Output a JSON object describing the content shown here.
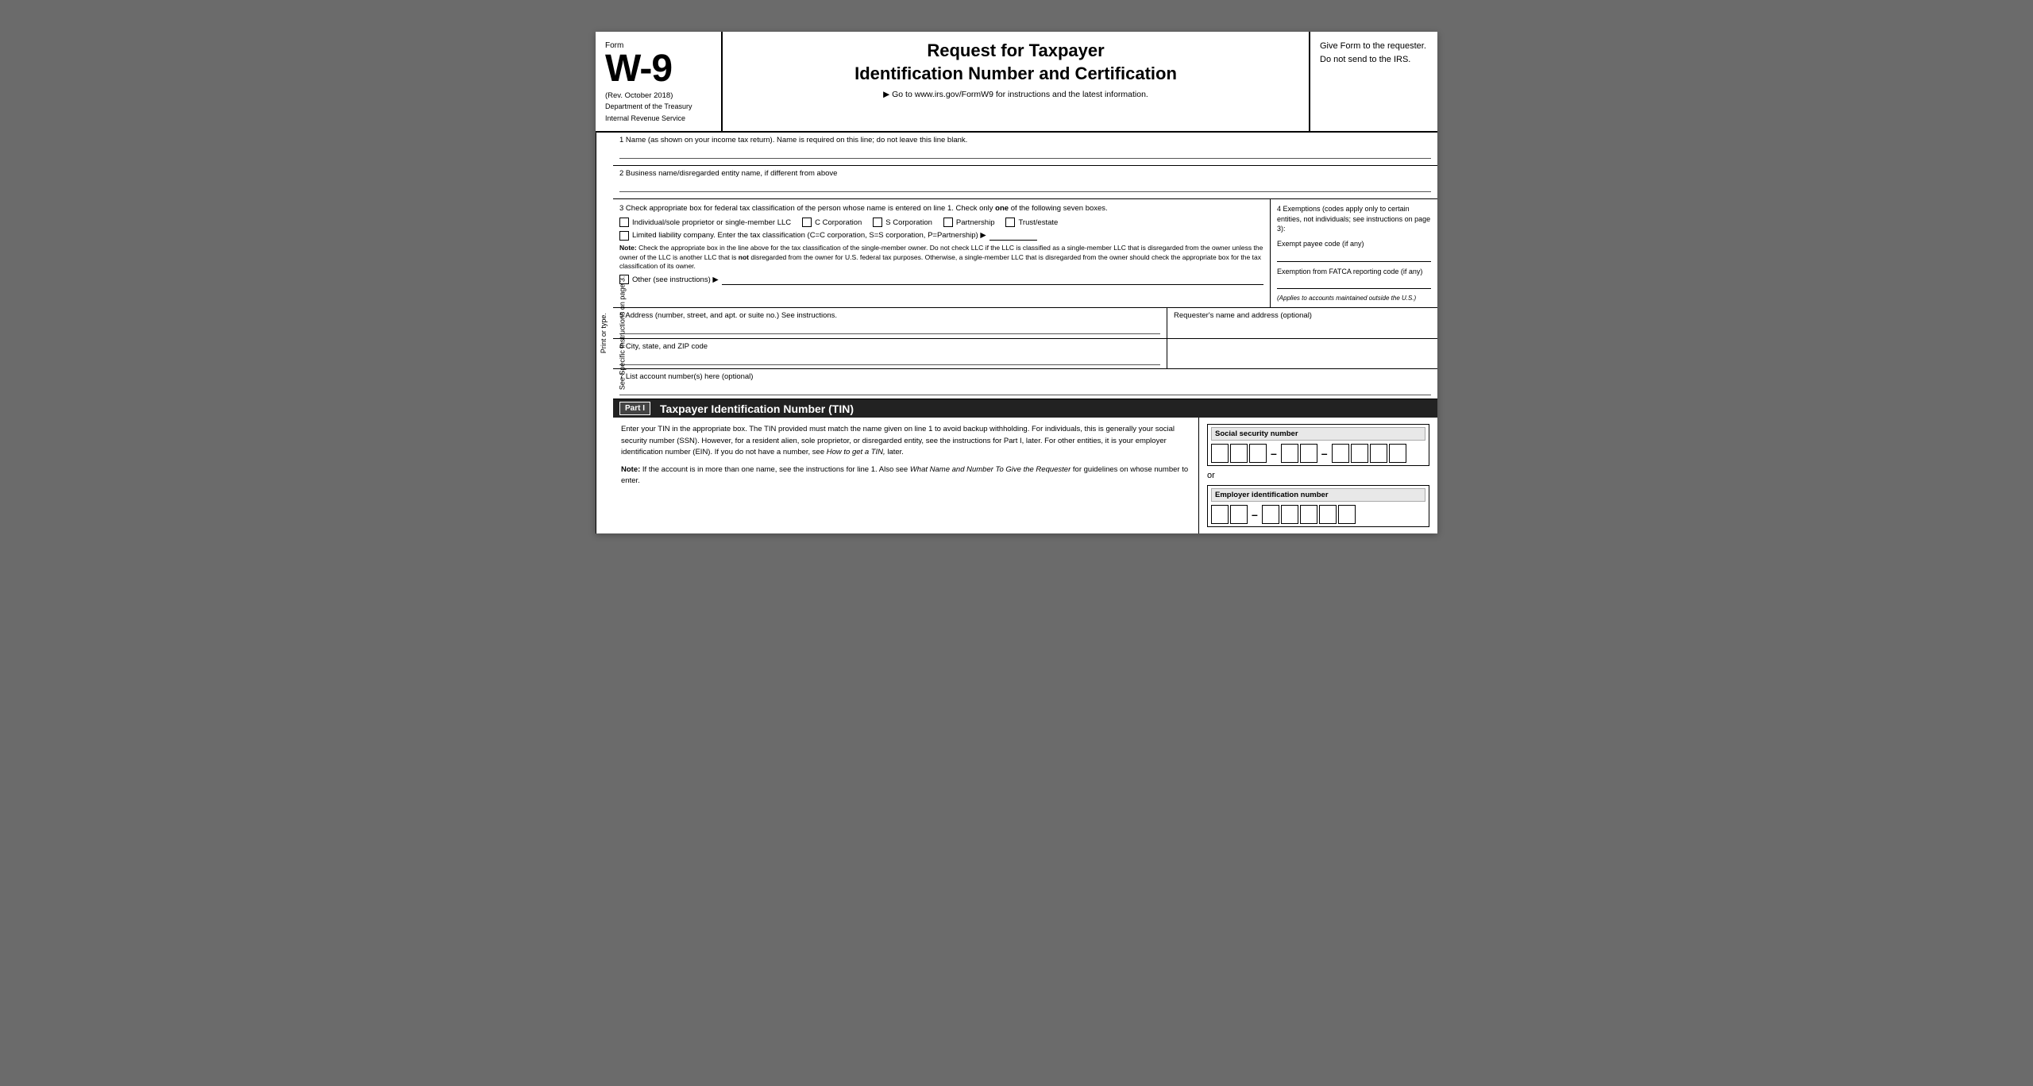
{
  "header": {
    "form_word": "Form",
    "form_number": "W-9",
    "rev": "(Rev. October 2018)",
    "dept1": "Department of the Treasury",
    "dept2": "Internal Revenue Service",
    "title_line1": "Request for Taxpayer",
    "title_line2": "Identification Number and Certification",
    "goto": "▶ Go to www.irs.gov/FormW9 for instructions and the latest information.",
    "give_form": "Give Form to the requester. Do not send to the IRS."
  },
  "fields": {
    "line1_label": "1  Name (as shown on your income tax return). Name is required on this line; do not leave this line blank.",
    "line2_label": "2  Business name/disregarded entity name, if different from above",
    "line3_label": "3  Check appropriate box for federal tax classification of the person whose name is entered on line 1. Check only",
    "line3_label_bold": "one",
    "line3_label_end": "of the following seven boxes.",
    "cb1": "Individual/sole proprietor or single-member LLC",
    "cb2": "C Corporation",
    "cb3": "S Corporation",
    "cb4": "Partnership",
    "cb5": "Trust/estate",
    "llc_text": "Limited liability company. Enter the tax classification (C=C corporation, S=S corporation, P=Partnership) ▶",
    "note_label": "Note:",
    "note_text": "Check the appropriate box in the line above for the tax classification of the single-member owner.  Do not check LLC if the LLC is classified as a single-member LLC that is disregarded from the owner unless the owner of the LLC is another LLC that is",
    "note_not": "not",
    "note_text2": "disregarded from the owner for U.S. federal tax purposes. Otherwise, a single-member LLC that is disregarded from the owner should check the appropriate box for the tax classification of its owner.",
    "other_text": "Other (see instructions) ▶",
    "exemptions_title": "4  Exemptions (codes apply only to certain entities, not individuals; see instructions on page 3):",
    "exempt_payee_label": "Exempt payee code (if any)",
    "exempt_fatca_label": "Exemption from FATCA reporting code (if any)",
    "exempt_applies": "(Applies to accounts maintained outside the U.S.)",
    "line5_label": "5  Address (number, street, and apt. or suite no.) See instructions.",
    "requester_label": "Requester's name and address (optional)",
    "line6_label": "6  City, state, and ZIP code",
    "line7_label": "7  List account number(s) here (optional)"
  },
  "part1": {
    "part_label": "Part I",
    "part_title": "Taxpayer Identification Number (TIN)",
    "body_text": "Enter your TIN in the appropriate box. The TIN provided must match the name given on line 1 to avoid backup withholding. For individuals, this is generally your social security number (SSN). However, for a resident alien, sole proprietor, or disregarded entity, see the instructions for Part I, later. For other entities, it is your employer identification number (EIN). If you do not have a number, see",
    "how_to_get": "How to get a TIN,",
    "body_text2": "later.",
    "note_label": "Note:",
    "note_text": "If the account is in more than one name, see the instructions for line 1. Also see",
    "what_name": "What Name and Number To Give the Requester",
    "note_text2": "for guidelines on whose number to enter.",
    "ssn_label": "Social security number",
    "or_text": "or",
    "ein_label": "Employer identification number"
  }
}
